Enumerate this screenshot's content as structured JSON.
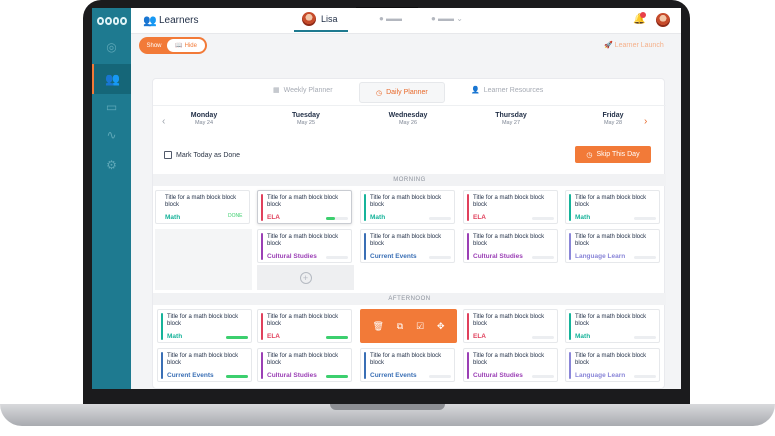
{
  "header": {
    "title": "Learners",
    "active_learner": "Lisa"
  },
  "toggle": {
    "show_label": "Show",
    "hide_label": "Hide"
  },
  "launch_label": "Learner Launch",
  "planner_tabs": [
    {
      "label": "Weekly Planner",
      "icon": "calendar-grid-icon"
    },
    {
      "label": "Daily Planner",
      "icon": "clock-icon"
    },
    {
      "label": "Learner Resources",
      "icon": "user-icon"
    }
  ],
  "days": [
    {
      "name": "Monday",
      "date": "May 24"
    },
    {
      "name": "Tuesday",
      "date": "May 25"
    },
    {
      "name": "Wednesday",
      "date": "May 26"
    },
    {
      "name": "Thursday",
      "date": "May 27"
    },
    {
      "name": "Friday",
      "date": "May 28"
    }
  ],
  "mark_done_label": "Mark Today as Done",
  "skip_label": "Skip This Day",
  "sections": {
    "morning": "MORNING",
    "afternoon": "AFTERNOON"
  },
  "card_title": "Title for a math block block block",
  "done_label": "DONE",
  "colors": {
    "sidebar": "#1e7a90",
    "accent": "#f27a38",
    "math": "#16b39a",
    "ela": "#e0405c",
    "cultural": "#9b3fb5",
    "current": "#3a6fb5",
    "language": "#8a86d8"
  },
  "subjects": {
    "math": "Math",
    "ela": "ELA",
    "cultural": "Cultural Studies",
    "current": "Current Events",
    "language": "Language Learn"
  }
}
